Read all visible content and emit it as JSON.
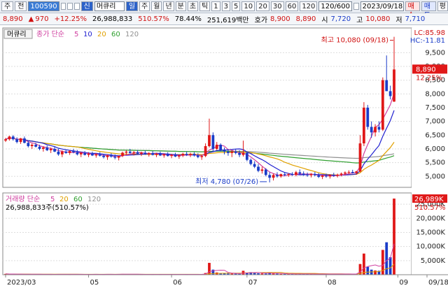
{
  "toolbar": {
    "market": "주",
    "period_mode": "전",
    "code": "100590",
    "badge": "신",
    "name": "머큐리",
    "btn_daily": "일",
    "btn_weekly": "주",
    "btn_monthly": "월",
    "btn_year": "년",
    "btn_minute": "분",
    "btn_second": "초",
    "btn_tick": "틱",
    "intervals": [
      "1",
      "3",
      "5",
      "10",
      "20",
      "30",
      "60",
      "120"
    ],
    "count": "120/600",
    "date": "2023/09/18",
    "buy": "매수",
    "sell": "매도",
    "avg": "평"
  },
  "quote": {
    "price": "8,890",
    "change": "970",
    "change_pct": "+12.25%",
    "volume": "26,988,833",
    "volume_ratio": "510.57%",
    "turnover": "78.44%",
    "amount": "251,619백만",
    "bid_label": "호가",
    "bid1": "8,900",
    "bid2": "8,890",
    "open_label": "시",
    "open": "7,720",
    "high_label": "고",
    "high": "10,080",
    "low_label": "저",
    "low": "7,710"
  },
  "chart_data": [
    {
      "type": "candlestick",
      "title": "머큐리",
      "legend": [
        {
          "name": "종가 단순",
          "color": "#d040a0"
        },
        {
          "name": "5",
          "color": "#d040a0"
        },
        {
          "name": "10",
          "color": "#2020d0"
        },
        {
          "name": "20",
          "color": "#e0a000"
        },
        {
          "name": "60",
          "color": "#30a030"
        },
        {
          "name": "120",
          "color": "#909090"
        }
      ],
      "y_ticks": [
        5000,
        5500,
        6000,
        6500,
        7000,
        7500,
        8000,
        8500,
        9000,
        9500
      ],
      "y_tick_labels": [
        "5,000",
        "5,500",
        "6,000",
        "6,500",
        "7,000",
        "7,500",
        "8,000",
        "8,500",
        "9,000",
        "9,500"
      ],
      "ylim": [
        4600,
        10400
      ],
      "x_ticks": [
        "2023/03",
        "05",
        "06",
        "07",
        "08",
        "09",
        "09/18"
      ],
      "annotations": {
        "high": "최고 10,080 (09/18)",
        "low": "최저 4,780 (07/26)",
        "lc": "LC:85.98",
        "hc": "HC:-11.81",
        "last_price": "8,890",
        "last_pct": "12.25%"
      },
      "ohlc": [
        [
          6300,
          6400,
          6250,
          6350
        ],
        [
          6350,
          6480,
          6300,
          6450
        ],
        [
          6450,
          6500,
          6300,
          6350
        ],
        [
          6350,
          6420,
          6200,
          6250
        ],
        [
          6250,
          6400,
          6180,
          6380
        ],
        [
          6380,
          6450,
          6200,
          6220
        ],
        [
          6220,
          6280,
          6050,
          6100
        ],
        [
          6100,
          6200,
          6000,
          6150
        ],
        [
          6150,
          6220,
          6050,
          6080
        ],
        [
          6080,
          6150,
          5950,
          6000
        ],
        [
          6000,
          6100,
          5900,
          6050
        ],
        [
          6050,
          6120,
          5920,
          5950
        ],
        [
          5950,
          6050,
          5850,
          6000
        ],
        [
          6000,
          6080,
          5880,
          5900
        ],
        [
          5900,
          6000,
          5750,
          5800
        ],
        [
          5800,
          5950,
          5700,
          5900
        ],
        [
          5900,
          5980,
          5820,
          5850
        ],
        [
          5850,
          5950,
          5780,
          5920
        ],
        [
          5920,
          6000,
          5840,
          5880
        ],
        [
          5880,
          5960,
          5760,
          5800
        ],
        [
          5800,
          5900,
          5700,
          5850
        ],
        [
          5850,
          5920,
          5760,
          5780
        ],
        [
          5780,
          5880,
          5700,
          5820
        ],
        [
          5820,
          5900,
          5740,
          5760
        ],
        [
          5760,
          5850,
          5680,
          5800
        ],
        [
          5800,
          5880,
          5720,
          5750
        ],
        [
          5750,
          5820,
          5650,
          5700
        ],
        [
          5700,
          5800,
          5600,
          5760
        ],
        [
          5760,
          5840,
          5680,
          5720
        ],
        [
          5720,
          5800,
          5620,
          5680
        ],
        [
          5680,
          5760,
          5580,
          5740
        ],
        [
          5740,
          5900,
          5700,
          5860
        ],
        [
          5860,
          5950,
          5780,
          5900
        ],
        [
          5900,
          6000,
          5820,
          5850
        ],
        [
          5850,
          5920,
          5760,
          5880
        ],
        [
          5880,
          5960,
          5800,
          5820
        ],
        [
          5820,
          5900,
          5740,
          5860
        ],
        [
          5860,
          5940,
          5780,
          5800
        ],
        [
          5800,
          5880,
          5720,
          5840
        ],
        [
          5840,
          5920,
          5760,
          5780
        ],
        [
          5780,
          5860,
          5700,
          5820
        ],
        [
          5820,
          5900,
          5740,
          5760
        ],
        [
          5760,
          5840,
          5680,
          5800
        ],
        [
          5800,
          5880,
          5720,
          5740
        ],
        [
          5740,
          5820,
          5660,
          5780
        ],
        [
          5780,
          5860,
          5700,
          5720
        ],
        [
          5720,
          5800,
          5640,
          5760
        ],
        [
          5760,
          5860,
          5700,
          5820
        ],
        [
          5820,
          5900,
          5740,
          5780
        ],
        [
          5780,
          5860,
          5700,
          5820
        ],
        [
          5820,
          5880,
          5720,
          5760
        ],
        [
          5760,
          5840,
          5660,
          5700
        ],
        [
          5700,
          5780,
          5600,
          5740
        ],
        [
          5740,
          6200,
          5700,
          6100
        ],
        [
          6100,
          7100,
          6050,
          6500
        ],
        [
          6500,
          6600,
          5900,
          6000
        ],
        [
          6000,
          6250,
          5950,
          6150
        ],
        [
          6150,
          6200,
          5900,
          5950
        ],
        [
          5950,
          6050,
          5800,
          5900
        ],
        [
          5900,
          6000,
          5750,
          5850
        ],
        [
          5850,
          5950,
          5700,
          5900
        ],
        [
          5900,
          6000,
          5800,
          5850
        ],
        [
          5850,
          5950,
          5700,
          5780
        ],
        [
          5780,
          6300,
          5720,
          5850
        ],
        [
          5850,
          5900,
          5550,
          5600
        ],
        [
          5600,
          5650,
          5400,
          5450
        ],
        [
          5450,
          5550,
          5300,
          5350
        ],
        [
          5350,
          5450,
          5150,
          5200
        ],
        [
          5200,
          5350,
          5100,
          5250
        ],
        [
          5250,
          5300,
          5000,
          5050
        ],
        [
          5050,
          5150,
          4780,
          4950
        ],
        [
          4950,
          5100,
          4850,
          5050
        ],
        [
          5050,
          5150,
          4950,
          5000
        ],
        [
          5000,
          5100,
          4950,
          5080
        ],
        [
          5080,
          5150,
          5000,
          5050
        ],
        [
          5050,
          5120,
          4980,
          5080
        ],
        [
          5080,
          5150,
          5020,
          5050
        ],
        [
          5050,
          5200,
          5000,
          5150
        ],
        [
          5150,
          5250,
          5050,
          5100
        ],
        [
          5100,
          5180,
          5020,
          5060
        ],
        [
          5060,
          5140,
          4980,
          5040
        ],
        [
          5040,
          5120,
          4960,
          5080
        ],
        [
          5080,
          5160,
          5000,
          5040
        ],
        [
          5040,
          5120,
          4940,
          4980
        ],
        [
          4980,
          5060,
          4900,
          5020
        ],
        [
          5020,
          5100,
          4950,
          5000
        ],
        [
          5000,
          5080,
          4920,
          5050
        ],
        [
          5050,
          5130,
          4980,
          5020
        ],
        [
          5020,
          5100,
          4960,
          5060
        ],
        [
          5060,
          5140,
          5000,
          5100
        ],
        [
          5100,
          5180,
          5040,
          5140
        ],
        [
          5140,
          5220,
          5080,
          5160
        ],
        [
          5160,
          5240,
          5100,
          5120
        ],
        [
          5120,
          5200,
          5060,
          5180
        ],
        [
          5180,
          6500,
          5150,
          6200
        ],
        [
          6200,
          7700,
          6100,
          7500
        ],
        [
          7500,
          7600,
          6700,
          6800
        ],
        [
          6800,
          7000,
          6400,
          6600
        ],
        [
          6600,
          6900,
          6450,
          6800
        ],
        [
          6800,
          7000,
          6600,
          6700
        ],
        [
          6700,
          8600,
          6650,
          8500
        ],
        [
          8500,
          9400,
          8300,
          8100
        ],
        [
          8100,
          8300,
          7800,
          7920
        ],
        [
          7720,
          10080,
          7710,
          8890
        ]
      ],
      "volume": {
        "legend": [
          {
            "name": "거래량 단순",
            "color": "#d040a0"
          },
          {
            "name": "5",
            "color": "#d040a0"
          },
          {
            "name": "20",
            "color": "#e0a000"
          },
          {
            "name": "60",
            "color": "#30a030"
          },
          {
            "name": "120",
            "color": "#909090"
          }
        ],
        "summary": "26,988,833주(510.57%)",
        "last_label": "26,989K",
        "last_pct": "510.57%",
        "y_ticks": [
          5000,
          10000,
          15000,
          20000,
          25000
        ],
        "y_tick_labels": [
          "5,000K",
          "10,000K",
          "15,000K",
          "20,000K",
          "25,000K"
        ],
        "ylim": [
          0,
          28000
        ],
        "values": [
          300,
          200,
          250,
          150,
          200,
          180,
          220,
          150,
          160,
          140,
          130,
          150,
          120,
          140,
          180,
          160,
          150,
          120,
          130,
          140,
          150,
          130,
          120,
          140,
          160,
          130,
          120,
          150,
          130,
          140,
          150,
          260,
          200,
          150,
          140,
          130,
          120,
          140,
          130,
          120,
          130,
          120,
          140,
          150,
          130,
          120,
          140,
          130,
          120,
          150,
          140,
          130,
          150,
          600,
          4200,
          1800,
          800,
          600,
          500,
          450,
          400,
          350,
          300,
          1400,
          700,
          900,
          600,
          500,
          450,
          400,
          800,
          450,
          350,
          300,
          280,
          260,
          250,
          300,
          270,
          260,
          250,
          240,
          260,
          250,
          240,
          230,
          250,
          260,
          240,
          230,
          250,
          260,
          240,
          250,
          3800,
          7500,
          2800,
          1800,
          1500,
          1400,
          8800,
          11500,
          6200,
          26989
        ]
      }
    }
  ]
}
